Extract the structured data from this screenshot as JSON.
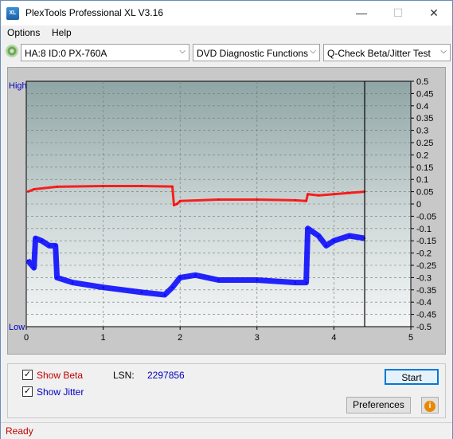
{
  "window": {
    "title": "PlexTools Professional XL V3.16",
    "icon_text": "XL"
  },
  "menu": {
    "items": [
      "Options",
      "Help"
    ]
  },
  "toolbar": {
    "drive": "HA:8 ID:0  PX-760A",
    "function": "DVD Diagnostic Functions",
    "test": "Q-Check Beta/Jitter Test"
  },
  "chart_data": {
    "type": "line",
    "x_ticks": [
      "0",
      "1",
      "2",
      "3",
      "4",
      "5"
    ],
    "xlim": [
      0,
      5
    ],
    "y_left_labels": {
      "high": "High",
      "low": "Low"
    },
    "y_right_ticks": [
      "0.5",
      "0.45",
      "0.4",
      "0.35",
      "0.3",
      "0.25",
      "0.2",
      "0.15",
      "0.1",
      "0.05",
      "0",
      "-0.05",
      "-0.1",
      "-0.15",
      "-0.2",
      "-0.25",
      "-0.3",
      "-0.35",
      "-0.4",
      "-0.45",
      "-0.5"
    ],
    "ylim": [
      -0.5,
      0.5
    ],
    "cursor_x": 4.4,
    "series": [
      {
        "color": "#ff0000",
        "points": [
          [
            0.02,
            0.05
          ],
          [
            0.1,
            0.06
          ],
          [
            0.4,
            0.07
          ],
          [
            1.0,
            0.073
          ],
          [
            1.5,
            0.073
          ],
          [
            1.9,
            0.071
          ],
          [
            1.92,
            -0.005
          ],
          [
            1.96,
            0.0
          ],
          [
            2.0,
            0.012
          ],
          [
            2.5,
            0.018
          ],
          [
            3.0,
            0.018
          ],
          [
            3.5,
            0.015
          ],
          [
            3.64,
            0.012
          ],
          [
            3.66,
            0.04
          ],
          [
            3.8,
            0.035
          ],
          [
            4.0,
            0.04
          ],
          [
            4.2,
            0.045
          ],
          [
            4.4,
            0.05
          ]
        ]
      },
      {
        "color": "#0000ff",
        "points": [
          [
            0.02,
            -0.23
          ],
          [
            0.1,
            -0.26
          ],
          [
            0.12,
            -0.14
          ],
          [
            0.2,
            -0.15
          ],
          [
            0.3,
            -0.17
          ],
          [
            0.38,
            -0.17
          ],
          [
            0.4,
            -0.3
          ],
          [
            0.6,
            -0.32
          ],
          [
            1.0,
            -0.34
          ],
          [
            1.5,
            -0.36
          ],
          [
            1.8,
            -0.37
          ],
          [
            1.9,
            -0.34
          ],
          [
            2.0,
            -0.3
          ],
          [
            2.2,
            -0.29
          ],
          [
            2.5,
            -0.31
          ],
          [
            3.0,
            -0.31
          ],
          [
            3.5,
            -0.32
          ],
          [
            3.64,
            -0.32
          ],
          [
            3.66,
            -0.1
          ],
          [
            3.8,
            -0.13
          ],
          [
            3.9,
            -0.17
          ],
          [
            4.0,
            -0.15
          ],
          [
            4.2,
            -0.13
          ],
          [
            4.4,
            -0.14
          ]
        ]
      }
    ]
  },
  "options": {
    "show_beta": "Show Beta",
    "show_beta_checked": true,
    "show_jitter": "Show Jitter",
    "show_jitter_checked": true,
    "lsn_label": "LSN:",
    "lsn_value": "2297856"
  },
  "buttons": {
    "start": "Start",
    "preferences": "Preferences",
    "info": "i"
  },
  "status": {
    "text": "Ready"
  },
  "colors": {
    "beta": "#ff0000",
    "jitter": "#0000ff",
    "status_text": "#c00000"
  }
}
